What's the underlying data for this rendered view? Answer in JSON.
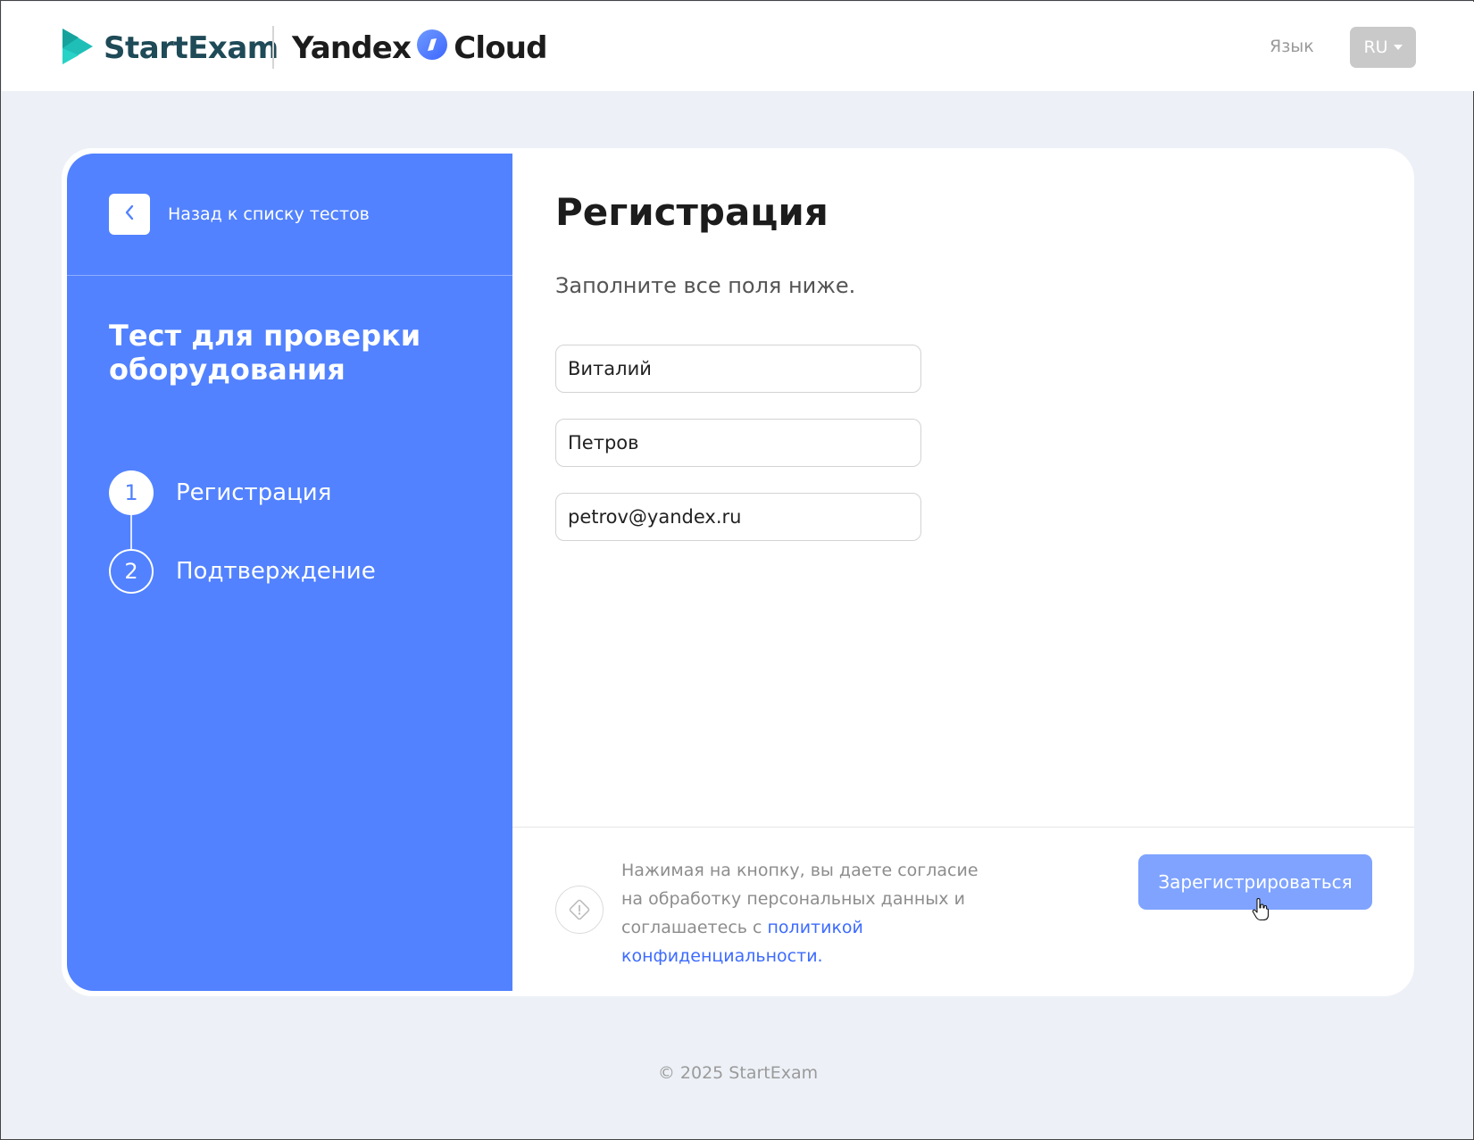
{
  "header": {
    "brand": "StartExam",
    "partner": "Yandex",
    "partner_suffix": "Cloud",
    "lang_label": "Язык",
    "lang_value": "RU"
  },
  "sidebar": {
    "back_label": "Назад к списку тестов",
    "test_title": "Тест для проверки оборудования",
    "steps": [
      {
        "number": "1",
        "label": "Регистрация",
        "state": "active"
      },
      {
        "number": "2",
        "label": "Подтверждение",
        "state": "pending"
      }
    ]
  },
  "main": {
    "title": "Регистрация",
    "subtitle": "Заполните все поля ниже.",
    "fields": {
      "first_name": "Виталий",
      "last_name": "Петров",
      "email": "petrov@yandex.ru"
    },
    "consent_text": "Нажимая на кнопку, вы даете согласие на обработку персональных данных и соглашаетесь с ",
    "consent_link": "политикой конфиденциальности",
    "consent_end": ".",
    "register_label": "Зарегистрироваться"
  },
  "footer": {
    "copyright": "© 2025 StartExam"
  },
  "colors": {
    "accent": "#5282ff",
    "button": "#7fa3ff",
    "link": "#3d6bff",
    "background": "#edf1f7"
  },
  "icons": {
    "logo": "startexam-logo-icon",
    "partner_logo": "yandex-cloud-logo-icon",
    "back": "chevron-left-icon",
    "info": "info-diamond-icon",
    "cursor": "hand-pointer-icon"
  }
}
